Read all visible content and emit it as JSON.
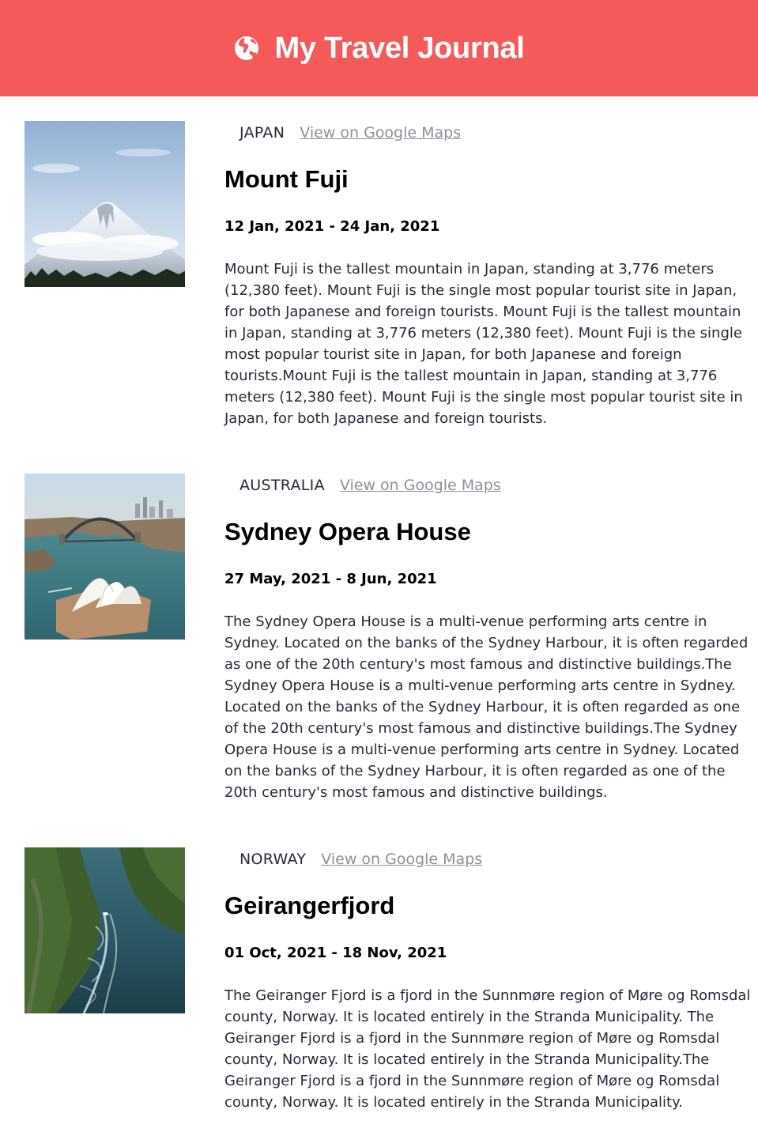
{
  "header": {
    "title": "My Travel Journal",
    "icon": "globe-icon",
    "background_color": "#F55A5A"
  },
  "entries": [
    {
      "location": "JAPAN",
      "maps_link_label": "View on Google Maps",
      "title": "Mount Fuji",
      "dates": "12 Jan, 2021 - 24 Jan, 2021",
      "description": "Mount Fuji is the tallest mountain in Japan, standing at 3,776 meters (12,380 feet). Mount Fuji is the single most popular tourist site in Japan, for both Japanese and foreign tourists. Mount Fuji is the tallest mountain in Japan, standing at 3,776 meters (12,380 feet). Mount Fuji is the single most popular tourist site in Japan, for both Japanese and foreign tourists.Mount Fuji is the tallest mountain in Japan, standing at 3,776 meters (12,380 feet). Mount Fuji is the single most popular tourist site in Japan, for both Japanese and foreign tourists."
    },
    {
      "location": "AUSTRALIA",
      "maps_link_label": "View on Google Maps",
      "title": "Sydney Opera House",
      "dates": "27 May, 2021 - 8 Jun, 2021",
      "description": "The Sydney Opera House is a multi-venue performing arts centre in Sydney. Located on the banks of the Sydney Harbour, it is often regarded as one of the 20th century's most famous and distinctive buildings.The Sydney Opera House is a multi-venue performing arts centre in Sydney. Located on the banks of the Sydney Harbour, it is often regarded as one of the 20th century's most famous and distinctive buildings.The Sydney Opera House is a multi-venue performing arts centre in Sydney. Located on the banks of the Sydney Harbour, it is often regarded as one of the 20th century's most famous and distinctive buildings."
    },
    {
      "location": "NORWAY",
      "maps_link_label": "View on Google Maps",
      "title": "Geirangerfjord",
      "dates": "01 Oct, 2021 - 18 Nov, 2021",
      "description": "The Geiranger Fjord is a fjord in the Sunnmøre region of Møre og Romsdal county, Norway. It is located entirely in the Stranda Municipality. The Geiranger Fjord is a fjord in the Sunnmøre region of Møre og Romsdal county, Norway. It is located entirely in the Stranda Municipality.The Geiranger Fjord is a fjord in the Sunnmøre region of Møre og Romsdal county, Norway. It is located entirely in the Stranda Municipality."
    }
  ]
}
